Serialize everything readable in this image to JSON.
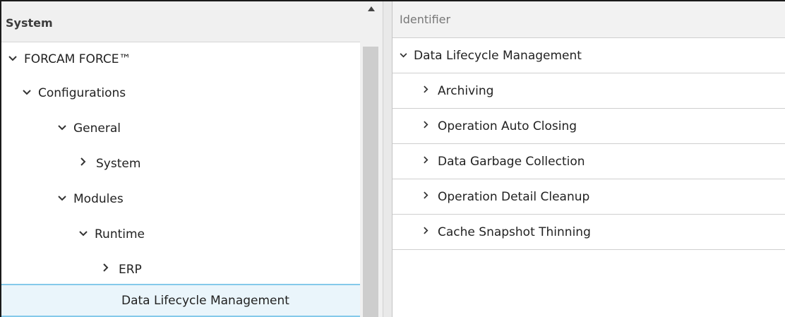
{
  "tree": {
    "header": "System",
    "items": [
      {
        "label": "FORCAM FORCE™",
        "state": "expanded"
      },
      {
        "label": "Configurations",
        "state": "expanded"
      },
      {
        "label": "General",
        "state": "expanded"
      },
      {
        "label": "System",
        "state": "collapsed"
      },
      {
        "label": "Modules",
        "state": "expanded"
      },
      {
        "label": "Runtime",
        "state": "expanded"
      },
      {
        "label": "ERP",
        "state": "collapsed"
      },
      {
        "label": "Data Lifecycle Management",
        "state": "leaf",
        "selected": true
      }
    ]
  },
  "grid": {
    "column_header": "Identifier",
    "rows": [
      {
        "label": "Data Lifecycle Management",
        "state": "expanded"
      },
      {
        "label": "Archiving",
        "state": "collapsed"
      },
      {
        "label": "Operation Auto Closing",
        "state": "collapsed"
      },
      {
        "label": "Data Garbage Collection",
        "state": "collapsed"
      },
      {
        "label": "Operation Detail Cleanup",
        "state": "collapsed"
      },
      {
        "label": "Cache Snapshot Thinning",
        "state": "collapsed"
      }
    ]
  },
  "icons": {
    "expanded": "chevron-down-icon",
    "collapsed": "chevron-right-icon",
    "scroll_up": "triangle-up-icon"
  },
  "colors": {
    "selection_border": "#84c9ea",
    "selection_fill": "#eaf5fb",
    "header_bg": "#f0f0f0"
  }
}
